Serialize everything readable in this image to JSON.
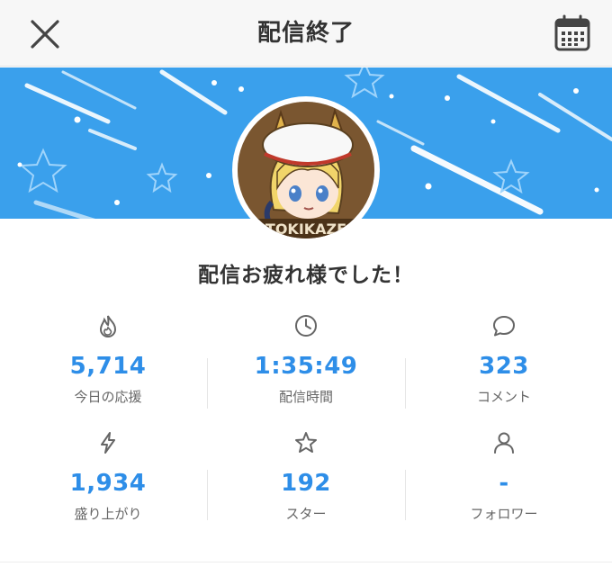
{
  "header": {
    "title": "配信終了",
    "close_icon": "close-icon",
    "calendar_icon": "calendar-icon"
  },
  "banner": {
    "color": "#3aa0ec"
  },
  "avatar": {
    "lettering": "TOKIKAZE"
  },
  "message": "配信お疲れ様でした！",
  "stats": [
    {
      "icon": "flame-icon",
      "value": "5,714",
      "label": "今日の応援"
    },
    {
      "icon": "clock-icon",
      "value": "1:35:49",
      "label": "配信時間"
    },
    {
      "icon": "speech-bubble-icon",
      "value": "323",
      "label": "コメント"
    },
    {
      "icon": "lightning-icon",
      "value": "1,934",
      "label": "盛り上がり"
    },
    {
      "icon": "star-icon",
      "value": "192",
      "label": "スター"
    },
    {
      "icon": "person-icon",
      "value": "-",
      "label": "フォロワー"
    }
  ],
  "accent_color": "#2e8ee8"
}
